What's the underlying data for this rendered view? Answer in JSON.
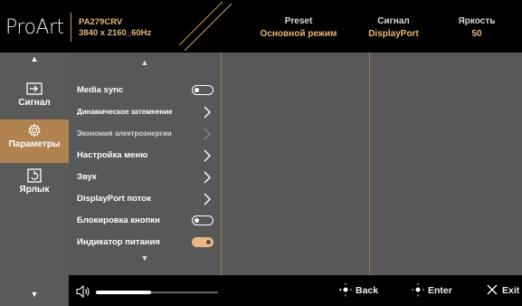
{
  "header": {
    "brand": "ProArt",
    "model": "PA279CRV",
    "resolution": "3840 x 2160_60Hz",
    "preset_label": "Preset",
    "preset_value": "Основной режим",
    "signal_label": "Сигнал",
    "signal_value": "DisplayPort",
    "brightness_label": "Яркость",
    "brightness_value": "50"
  },
  "sidebar": {
    "items": [
      {
        "label": "Сигнал",
        "icon": "input-icon",
        "active": false
      },
      {
        "label": "Параметры",
        "icon": "settings-icon",
        "active": true
      },
      {
        "label": "Ярлык",
        "icon": "shortcut-icon",
        "active": false
      }
    ]
  },
  "menu": {
    "items": [
      {
        "label": "Media sync",
        "control": "toggle",
        "state": "off"
      },
      {
        "label": "Динамическое затемнение",
        "control": "submenu"
      },
      {
        "label": "Экономия электроэнергии",
        "control": "submenu",
        "disabled": true
      },
      {
        "label": "Настройка меню",
        "control": "submenu"
      },
      {
        "label": "Звук",
        "control": "submenu"
      },
      {
        "label": "DisplayPort поток",
        "control": "submenu"
      },
      {
        "label": "Блокировка кнопки",
        "control": "toggle",
        "state": "off"
      },
      {
        "label": "Индикатор питания",
        "control": "toggle",
        "state": "on"
      }
    ]
  },
  "footer": {
    "volume_level": 0.45,
    "back_label": "Back",
    "enter_label": "Enter",
    "exit_label": "Exit"
  },
  "colors": {
    "accent": "#b08350",
    "header_value": "#e6b77a",
    "panel": "#585858",
    "sidebar": "#5a5a5a"
  }
}
